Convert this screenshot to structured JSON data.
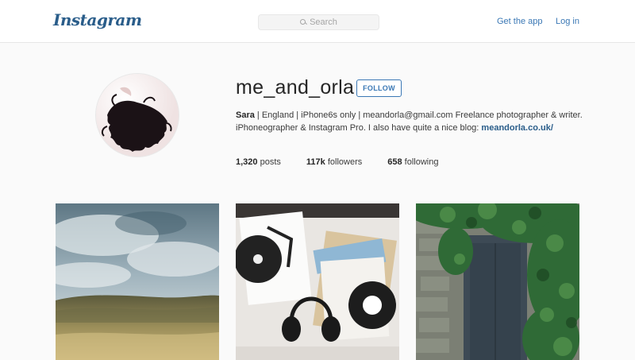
{
  "header": {
    "logo": "Instagram",
    "search_placeholder": "Search",
    "get_app": "Get the app",
    "login": "Log in"
  },
  "profile": {
    "username": "me_and_orla",
    "follow_label": "FOLLOW",
    "name": "Sara",
    "bio": " | England | iPhone6s only | meandorla@gmail.com Freelance photographer & writer. iPhoneographer & Instagram Pro. I also have quite a nice blog:",
    "website": "meandorla.co.uk/",
    "stats": [
      {
        "count": "1,320",
        "label": "posts"
      },
      {
        "count": "117k",
        "label": "followers"
      },
      {
        "count": "658",
        "label": "following"
      }
    ]
  },
  "photos": [
    {
      "subject": "cloudy-moorland"
    },
    {
      "subject": "vinyl-records-headphones"
    },
    {
      "subject": "ivy-covered-door"
    }
  ]
}
